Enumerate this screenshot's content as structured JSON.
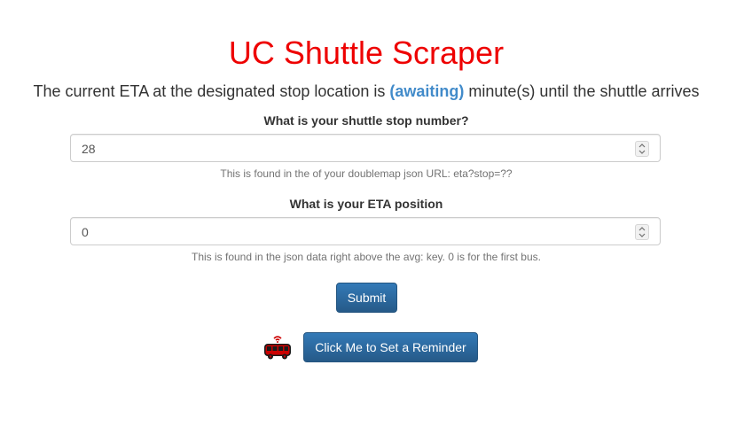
{
  "header": {
    "title": "UC Shuttle Scraper"
  },
  "eta": {
    "prefix": "The current ETA at the designated stop location is ",
    "value": "(awaiting)",
    "suffix": " minute(s) until the shuttle arrives"
  },
  "stop_form": {
    "label": "What is your shuttle stop number?",
    "value": "28",
    "help": "This is found in the of your doublemap json URL: eta?stop=??"
  },
  "eta_form": {
    "label": "What is your ETA position",
    "value": "0",
    "help": "This is found in the json data right above the avg: key. 0 is for the first bus."
  },
  "submit": {
    "label": "Submit"
  },
  "reminder": {
    "label": "Click Me to Set a Reminder",
    "icon": "bus-icon"
  },
  "colors": {
    "title": "#ee0000",
    "accent": "#428bca",
    "button": "#337ab7",
    "bus_icon": "#cc0000"
  }
}
